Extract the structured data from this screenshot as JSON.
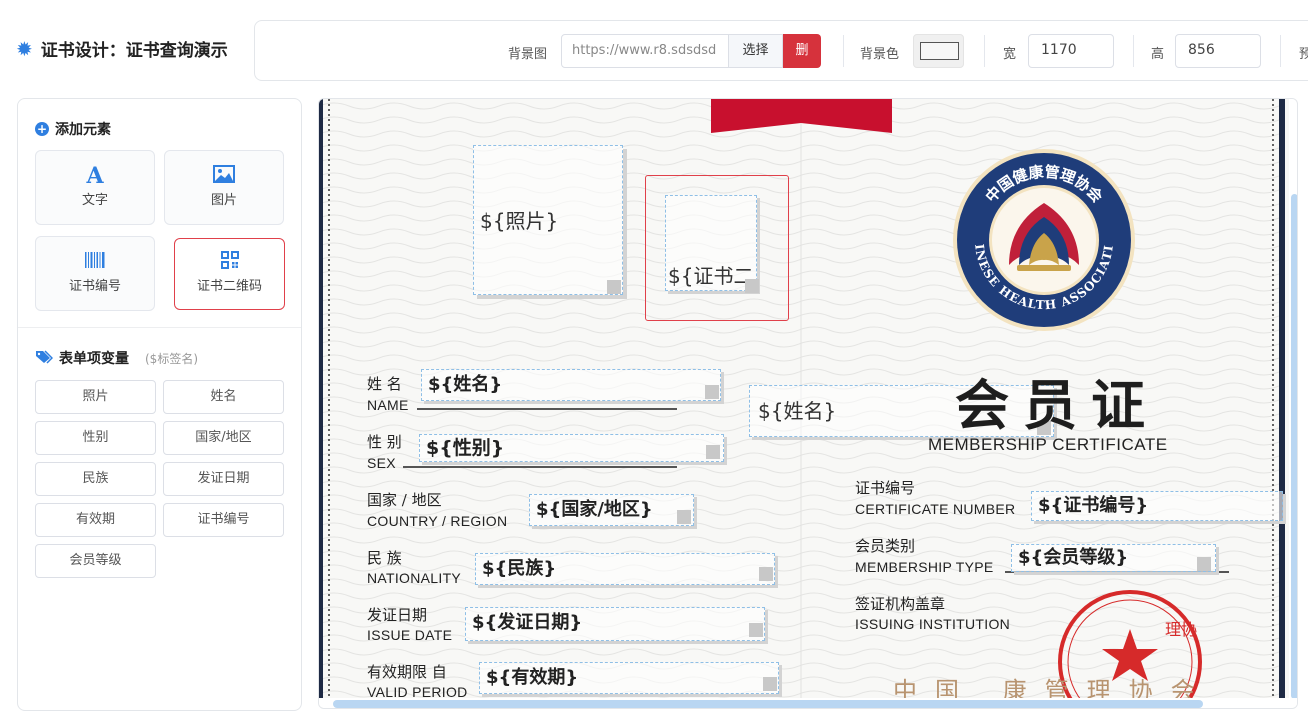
{
  "header": {
    "title": "证书设计：证书查询演示",
    "icon": "gear-icon"
  },
  "toolbar": {
    "bg_image_label": "背景图",
    "bg_image_value": "https://www.r8.sdsdsd",
    "choose_label": "选择",
    "delete_label": "删",
    "bg_color_label": "背景色",
    "bg_color_value": "#f7f7f7",
    "width_label": "宽",
    "width_value": "1170",
    "height_label": "高",
    "height_value": "856",
    "preview_label_partial": "预"
  },
  "add_elements": {
    "title": "添加元素",
    "tiles": [
      {
        "label": "文字",
        "icon": "text-icon"
      },
      {
        "label": "图片",
        "icon": "image-icon"
      },
      {
        "label": "证书编号",
        "icon": "barcode-icon"
      },
      {
        "label": "证书二维码",
        "icon": "qrcode-icon"
      }
    ]
  },
  "form_vars": {
    "title": "表单项变量",
    "hint": "($标签名)",
    "items": [
      "照片",
      "姓名",
      "性别",
      "国家/地区",
      "民族",
      "发证日期",
      "有效期",
      "证书编号",
      "会员等级"
    ]
  },
  "certificate": {
    "photo_placeholder": "${照片}",
    "qrcode_placeholder": "${证书二",
    "fields": [
      {
        "cn": "姓 名",
        "en": "NAME",
        "var": "${姓名}"
      },
      {
        "cn": "性 别",
        "en": "SEX",
        "var": "${性别}"
      },
      {
        "cn": "国家 / 地区",
        "en": "COUNTRY / REGION",
        "var": "${国家/地区}"
      },
      {
        "cn": "民 族",
        "en": "NATIONALITY",
        "var": "${民族}"
      },
      {
        "cn": "发证日期",
        "en": "ISSUE DATE",
        "var": "${发证日期}"
      },
      {
        "cn": "有效期限 自",
        "en": "VALID PERIOD",
        "var": "${有效期}"
      }
    ],
    "name_big_placeholder": "${姓名}",
    "title_cn": "会员证",
    "title_en": "MEMBERSHIP CERTIFICATE",
    "right_fields": [
      {
        "cn": "证书编号",
        "en": "CERTIFICATE NUMBER",
        "var": "${证书编号}"
      },
      {
        "cn": "会员类别",
        "en": "MEMBERSHIP TYPE",
        "var": "${会员等级}"
      },
      {
        "cn": "签证机构盖章",
        "en": "ISSUING INSTITUTION"
      }
    ],
    "logo_text": "中国健康管理协会",
    "logo_text_en": "CHINESE HEALTH ASSOCIATION",
    "bottom_org": "中国 康管理协会",
    "stamp_text": "理协"
  },
  "colors": {
    "accent": "#2f7fe0",
    "danger": "#d6323c",
    "ribbon": "#c8102e",
    "logo_blue": "#1f3d7a",
    "logo_gold": "#c9a34a",
    "stamp_red": "#d62a2a"
  }
}
